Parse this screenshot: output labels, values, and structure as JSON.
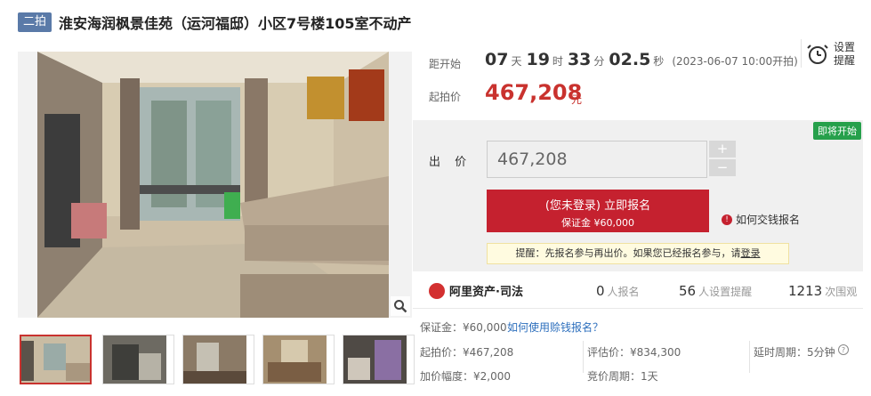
{
  "header": {
    "tag": "二拍",
    "title": "淮安海润枫景佳苑（运河福邸）小区7号楼105室不动产"
  },
  "gallery": {
    "main_image_icon": "house-interior-photo",
    "zoom_icon": "magnifier-icon",
    "thumb_count": 5,
    "active_thumb": 1
  },
  "countdown": {
    "label": "距开始",
    "days": "07",
    "day_unit": "天",
    "hours": "19",
    "hour_unit": "时",
    "minutes": "33",
    "minute_unit": "分",
    "seconds": "02.5",
    "second_unit": "秒",
    "start_text": "(2023-06-07 10:00开拍)"
  },
  "remind": {
    "line1": "设置",
    "line2": "提醒",
    "icon": "alarm-clock-icon"
  },
  "start_price": {
    "label": "起拍价",
    "value": "467,208",
    "unit": "元"
  },
  "bid": {
    "soon_badge": "即将开始",
    "label": "出 价",
    "input_value": "467,208",
    "plus": "+",
    "minus": "−",
    "signup_line1": "(您未登录) 立即报名",
    "signup_line2": "保证金 ¥60,000",
    "how_pay": "如何交钱报名",
    "notice_prefix": "提醒：先报名参与再出价。如果您已经报名参与，请",
    "notice_login": "登录"
  },
  "stats": {
    "brand": "阿里资产·司法",
    "signup_count": "0",
    "signup_label": "人报名",
    "remind_count": "56",
    "remind_label": "人设置提醒",
    "watch_count": "1213",
    "watch_label": "次围观"
  },
  "details": {
    "deposit": "保证金：¥60,000",
    "deposit_link": "如何使用赊钱报名？",
    "start_price": "起拍价：¥467,208",
    "appraisal": "评估价：¥834,300",
    "delay": "延时周期：5分钟",
    "increment": "加价幅度：¥2,000",
    "bid_period": "竞价周期：1天"
  },
  "colors": {
    "accent_red": "#c5212f",
    "price_red": "#c9322e",
    "tag_blue": "#5a7aa8",
    "badge_green": "#26a04b",
    "link_blue": "#2d6fbd"
  }
}
